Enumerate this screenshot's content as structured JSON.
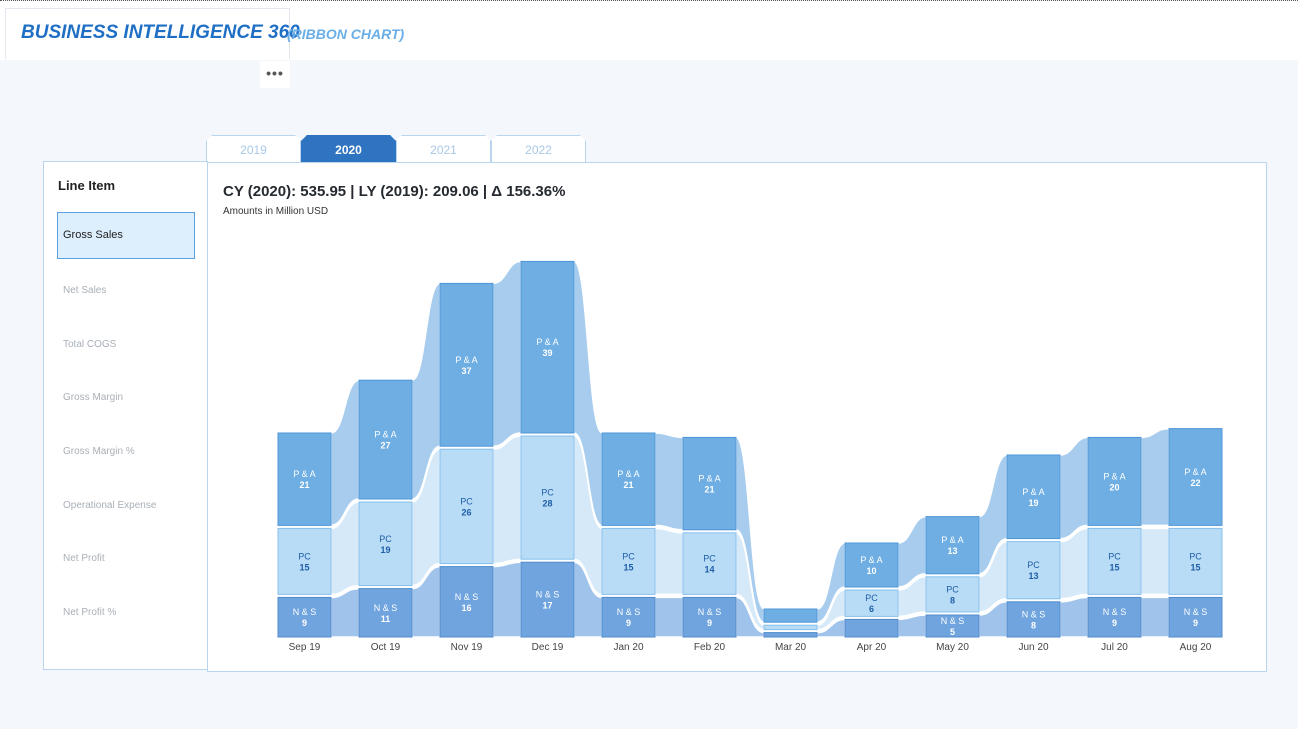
{
  "header": {
    "title": "BUSINESS INTELLIGENCE 360",
    "subtitle": "(RIBBON CHART)",
    "more_label": "•••"
  },
  "tabs": [
    {
      "label": "2019",
      "active": false
    },
    {
      "label": "2020",
      "active": true
    },
    {
      "label": "2021",
      "active": false
    },
    {
      "label": "2022",
      "active": false
    }
  ],
  "sidebar": {
    "title": "Line Item",
    "items": [
      {
        "label": "Gross Sales",
        "selected": true
      },
      {
        "label": "Net Sales",
        "selected": false
      },
      {
        "label": "Total COGS",
        "selected": false
      },
      {
        "label": "Gross Margin",
        "selected": false
      },
      {
        "label": "Gross Margin %",
        "selected": false
      },
      {
        "label": "Operational Expense",
        "selected": false
      },
      {
        "label": "Net Profit",
        "selected": false
      },
      {
        "label": "Net Profit %",
        "selected": false
      }
    ]
  },
  "summary": {
    "kpi": "CY (2020): 535.95 | LY (2019): 209.06 | Δ 156.36%",
    "units": "Amounts in Million USD"
  },
  "colors": {
    "accent": "#2f74c0",
    "title": "#1f6fc5",
    "subtitle": "#6aaee8",
    "pa_bar": "#6eaee3",
    "pc_bar": "#b8dbf6",
    "ns_bar": "#6fa4de",
    "pa_ribbon": "#a7cced",
    "pc_ribbon": "#d6e9f9",
    "ns_ribbon": "#9fc3ea"
  },
  "chart_data": {
    "type": "bar",
    "subtype": "ribbon",
    "categories": [
      "Sep 19",
      "Oct 19",
      "Nov 19",
      "Dec 19",
      "Jan 20",
      "Feb 20",
      "Mar 20",
      "Apr 20",
      "May 20",
      "Jun 20",
      "Jul 20",
      "Aug 20"
    ],
    "series": [
      {
        "name": "N & S",
        "values": [
          9,
          11,
          16,
          17,
          9,
          9,
          1,
          4,
          5,
          8,
          9,
          9
        ],
        "labels": [
          "9",
          "11",
          "16",
          "17",
          "9",
          "9",
          "",
          "",
          "5",
          "8",
          "9",
          "9"
        ]
      },
      {
        "name": "PC",
        "values": [
          15,
          19,
          26,
          28,
          15,
          14,
          1,
          6,
          8,
          13,
          15,
          15
        ],
        "labels": [
          "15",
          "19",
          "26",
          "28",
          "15",
          "14",
          "",
          "6",
          "8",
          "13",
          "15",
          "15"
        ]
      },
      {
        "name": "P & A",
        "values": [
          21,
          27,
          37,
          39,
          21,
          21,
          3,
          10,
          13,
          19,
          20,
          22
        ],
        "labels": [
          "21",
          "27",
          "37",
          "39",
          "21",
          "21",
          "",
          "10",
          "13",
          "19",
          "20",
          "22"
        ]
      }
    ],
    "ylim": [
      0,
      85
    ],
    "stacked": true,
    "grid": false,
    "legend": "none"
  }
}
